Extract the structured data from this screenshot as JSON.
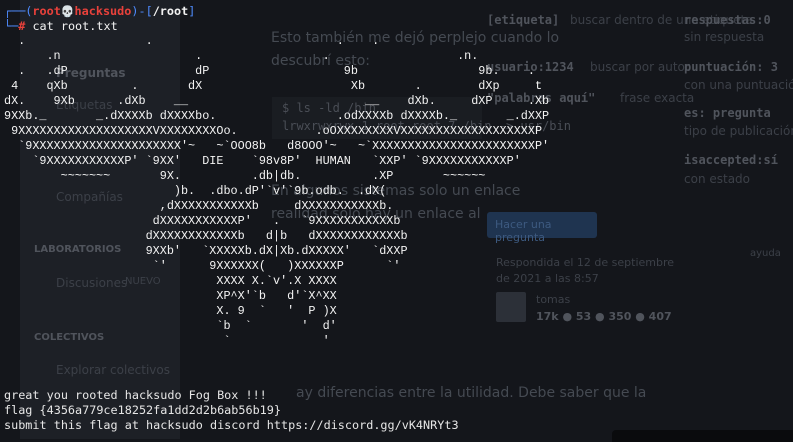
{
  "background_page": {
    "sidebar": [
      "Preguntas",
      "Etiquetas",
      "Compañías",
      "LABORATORIOS",
      "Discusiones",
      "NUEVO",
      "COLECTIVOS",
      "Explorar colectivos"
    ],
    "body_text": [
      "Esto también me dejó perplejo cuando lo",
      "descubrí esto:",
      "$ ls -ld /bin",
      "lrwxrwxrwx 1 root root 7 /bin -> usr/bin",
      "En algunos sistemas solo un enlace",
      "realidad solo hay un enlace al",
      "ay diferencias entre la utilidad. Debe saber que la"
    ],
    "search_help": [
      {
        "key": "[etiqueta]",
        "desc": "buscar dentro de una etiqueta"
      },
      {
        "key": "usuario:1234",
        "desc": "buscar por autor"
      },
      {
        "key": "\"palabras aquí\"",
        "desc": "frase exacta"
      },
      {
        "key": "respuestas:0",
        "desc": "sin respuesta"
      },
      {
        "key": "puntuación: 3",
        "desc": "con una puntuación"
      },
      {
        "key": "es: pregunta",
        "desc": "tipo de publicación"
      },
      {
        "key": "isaccepted:sí",
        "desc": "con estado"
      }
    ],
    "ask_button": "Hacer una pregunta",
    "answered_line1": "Respondida el 12 de septiembre",
    "answered_line2": "de 2021 a las 8:57",
    "username": "tomas",
    "user_stats": "17k ● 53 ● 350 ● 407",
    "help_link": "ayuda"
  },
  "terminal": {
    "prompt": {
      "open": "┌──(",
      "user": "root",
      "skull": "💀",
      "host": "hacksudo",
      "sep": ")-[",
      "path": "/root",
      "close": "]",
      "branch": "└─",
      "symbol": "#"
    },
    "command": "cat root.txt",
    "ascii_art": "  .                 .                          .    .\n      .n                   .                 .                  .n.\n  .   .dP                  dP                   9b                 9b.    .\n 4    qXb         .       dX                     Xb       .        dXp     t\ndX.    9Xb      .dXb    __                         __    dXb.     dXP     .Xb\n9XXb._       _.dXXXXb dXXXXbo.                 .odXXXXb dXXXXb._       _.dXXP\n 9XXXXXXXXXXXXXXXXXXXVXXXXXXXXOo.           .oOXXXXXXXXVXXXXXXXXXXXXXXXXXXXP\n  `9XXXXXXXXXXXXXXXXXXXXX'~   ~`OOO8b   d8OOO'~   ~`XXXXXXXXXXXXXXXXXXXXXXXP'\n    `9XXXXXXXXXXXP' `9XX'   DIE    `98v8P'  HUMAN   `XXP' `9XXXXXXXXXXXP'\n        ~~~~~~~       9X.          .db|db.          .XP       ~~~~~~\n                        )b.  .dbo.dP'`v'`9b.odb.  .dX(\n                      ,dXXXXXXXXXXXb     dXXXXXXXXXXXb.\n                     dXXXXXXXXXXXP'   .   `9XXXXXXXXXXXb\n                    dXXXXXXXXXXXXb   d|b   dXXXXXXXXXXXXb\n                    9XXb'   `XXXXXb.dX|Xb.dXXXXX'   `dXXP\n                     `'      9XXXXXX(   )XXXXXXP      `'\n                              XXXX X.`v'.X XXXX\n                              XP^X'`b   d'`X^XX\n                              X. 9  `   '  P )X\n                              `b  `       '  d'\n                               `             '",
    "message": "great you rooted hacksudo Fog Box !!!",
    "flag": "flag {4356a779ce18252fa1dd2d2b6ab56b19}",
    "submit": "submit this flag at hacksudo discord https://discord.gg/vK4NRYt3"
  }
}
